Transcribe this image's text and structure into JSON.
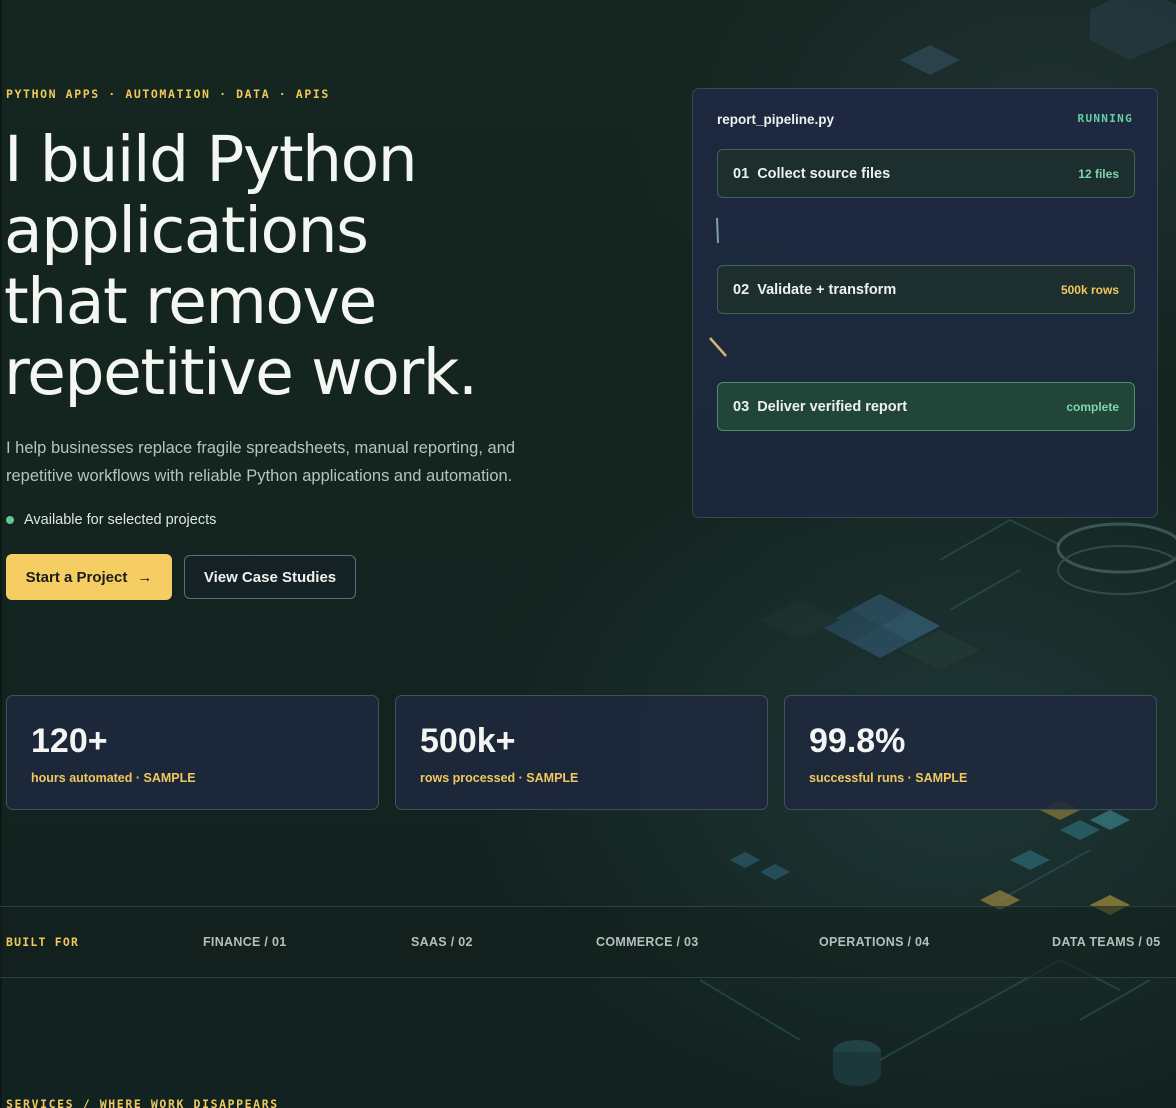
{
  "hero": {
    "eyebrow": "PYTHON APPS · AUTOMATION · DATA · APIS",
    "headline": [
      "I build Python",
      "applications",
      "that remove",
      "repetitive work."
    ],
    "lede": [
      "I help businesses replace fragile spreadsheets, manual reporting, and",
      "repetitive workflows with reliable Python applications and automation."
    ],
    "availability": "Available for selected projects",
    "primary_button": "Start a Project",
    "primary_button_icon": "→",
    "secondary_button": "View Case Studies"
  },
  "pipeline": {
    "title": "report_pipeline.py",
    "status": "RUNNING",
    "steps": [
      {
        "number": "01",
        "name": "Collect source files",
        "meta": "12 files",
        "meta_color": "#7fd6ad"
      },
      {
        "number": "02",
        "name": "Validate + transform",
        "meta": "500k rows",
        "meta_color": "#f0c95e"
      },
      {
        "number": "03",
        "name": "Deliver verified report",
        "meta": "complete",
        "meta_color": "#7fd6ad"
      }
    ]
  },
  "stats": [
    {
      "value": "120+",
      "label": "hours automated · SAMPLE"
    },
    {
      "value": "500k+",
      "label": "rows processed · SAMPLE"
    },
    {
      "value": "99.8%",
      "label": "successful runs · SAMPLE"
    }
  ],
  "built_for": {
    "label": "BUILT FOR",
    "items": [
      "FINANCE / 01",
      "SAAS / 02",
      "COMMERCE / 03",
      "OPERATIONS / 04",
      "DATA TEAMS / 05"
    ]
  },
  "services": {
    "heading": "SERVICES / WHERE WORK DISAPPEARS"
  },
  "colors": {
    "background": "#142420",
    "accent": "#f5cd63",
    "success": "#63c794"
  }
}
